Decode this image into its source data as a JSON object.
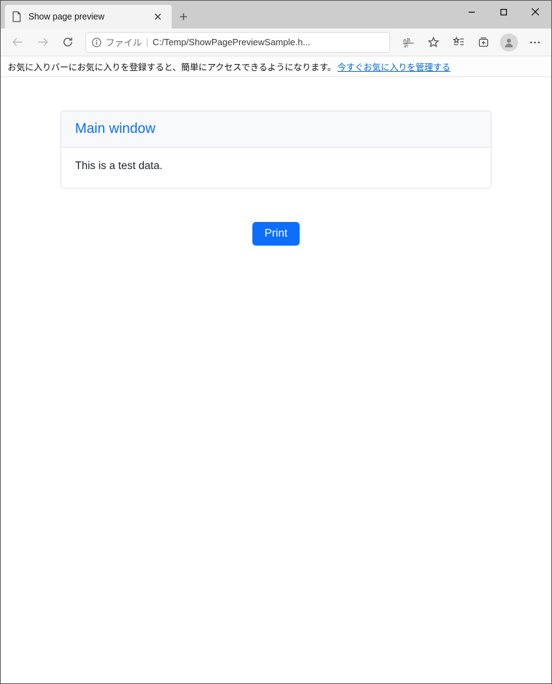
{
  "browser": {
    "tab_title": "Show page preview",
    "address": {
      "file_label": "ファイル",
      "path": "C:/Temp/ShowPagePreviewSample.h..."
    },
    "favorites_bar": {
      "message": "お気に入りバーにお気に入りを登録すると、簡単にアクセスできるようになります。",
      "link": "今すぐお気に入りを管理する"
    }
  },
  "page": {
    "card_title": "Main window",
    "card_body": "This is a test data.",
    "print_button": "Print"
  }
}
